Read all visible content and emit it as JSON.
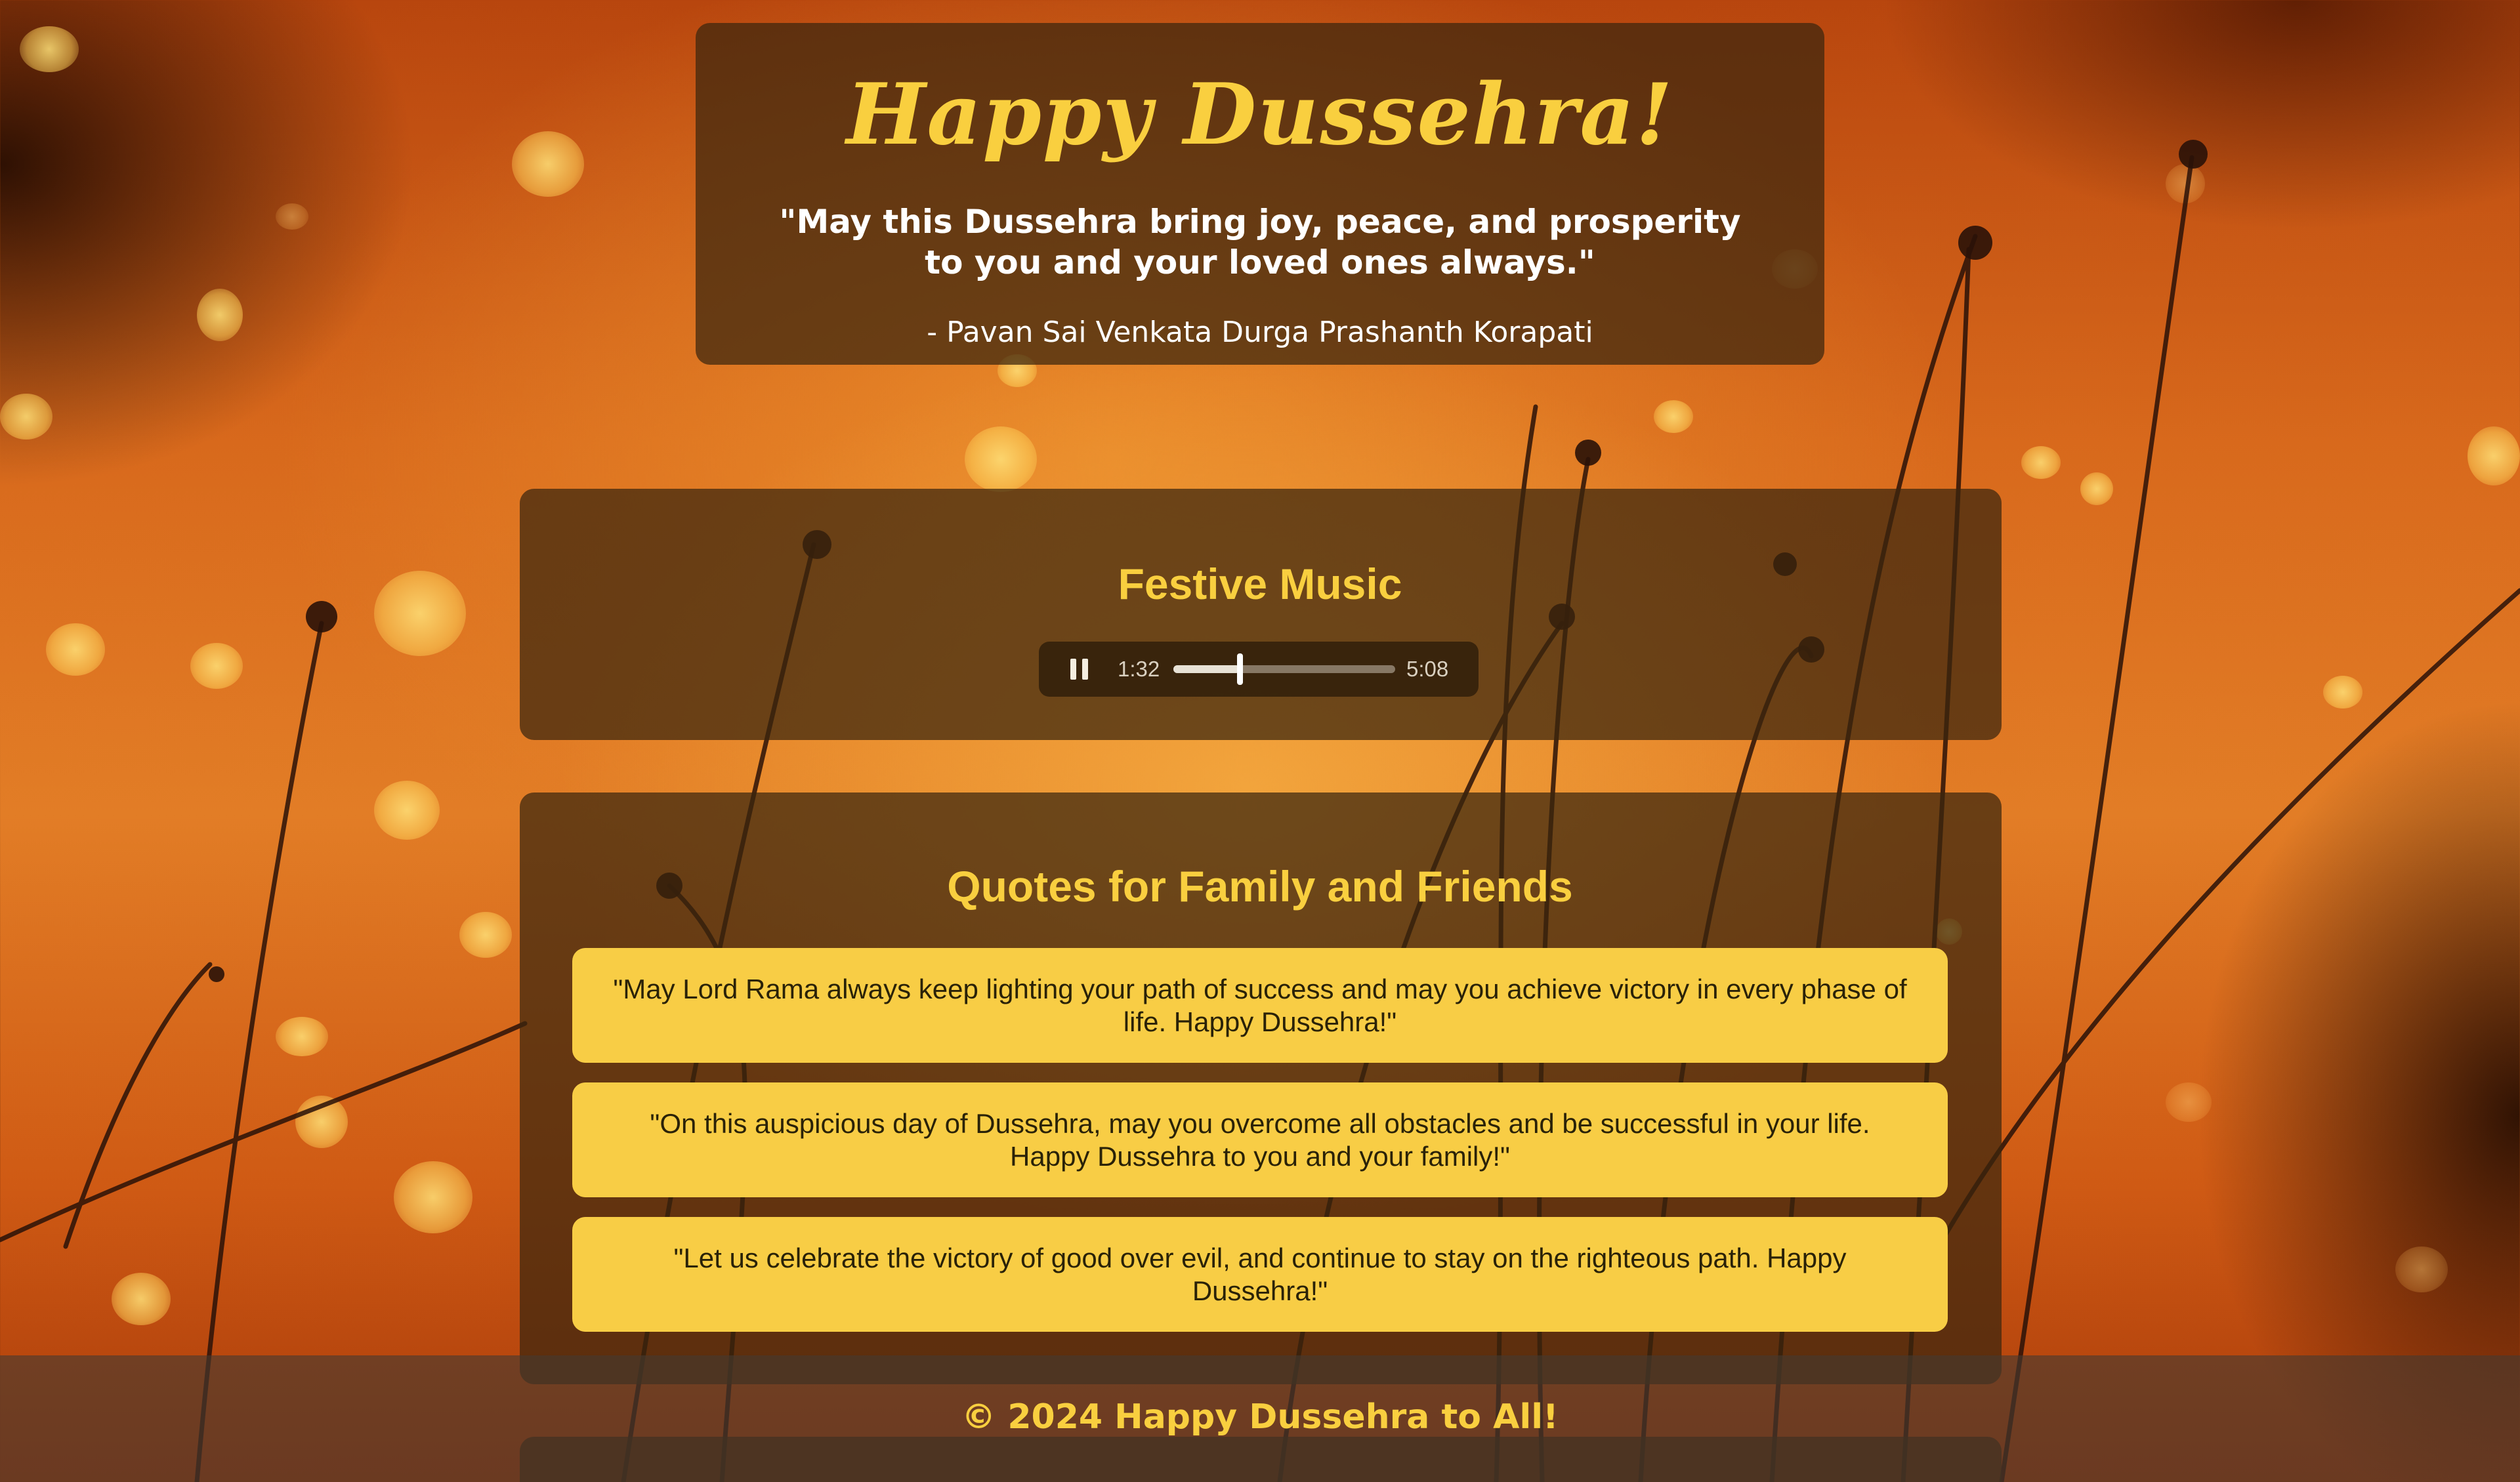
{
  "header": {
    "title": "Happy Dussehra!",
    "quote": "\"May this Dussehra bring joy, peace, and prosperity to you and your loved ones always.\"",
    "author": "- Pavan Sai Venkata Durga Prashanth Korapati"
  },
  "music": {
    "title": "Festive Music",
    "player": {
      "current_time": "1:32",
      "total_time": "5:08",
      "progress_fraction": 0.3,
      "state": "playing",
      "button_icon": "pause-icon"
    }
  },
  "quotes": {
    "title": "Quotes for Family and Friends",
    "items": [
      "\"May Lord Rama always keep lighting your path of success and may you achieve victory in every phase of life. Happy Dussehra!\"",
      "\"On this auspicious day of Dussehra, may you overcome all obstacles and be successful in your life. Happy Dussehra to you and your family!\"",
      "\"Let us celebrate the victory of good over evil, and continue to stay on the righteous path. Happy Dussehra!\""
    ]
  },
  "footer": {
    "text": "© 2024 Happy Dussehra to All!"
  },
  "colors": {
    "accent_gold": "#f9cf3f",
    "card_yellow": "#f8cd45",
    "panel_brown": "#3a260e",
    "background_orange": "#e27d26"
  }
}
